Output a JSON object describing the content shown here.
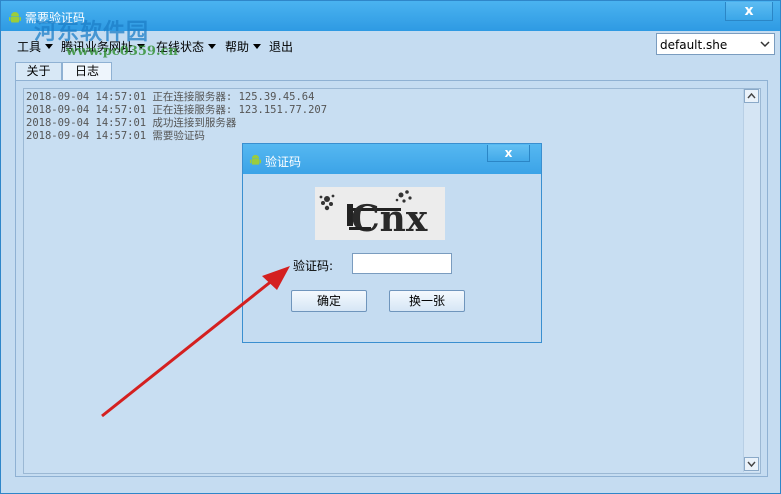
{
  "window": {
    "title": "需要验证码",
    "close_label": "x"
  },
  "watermark": {
    "text": "河东软件园",
    "url": "www.pc0359.cn"
  },
  "menu": {
    "items": [
      {
        "label": "工具",
        "dropdown": true
      },
      {
        "label": "腾讯业务网址",
        "dropdown": true
      },
      {
        "label": "在线状态",
        "dropdown": true
      },
      {
        "label": "帮助",
        "dropdown": true
      },
      {
        "label": "退出",
        "dropdown": false
      }
    ]
  },
  "combo": {
    "selected": "default.she"
  },
  "tabs": [
    {
      "label": "关于",
      "active": false
    },
    {
      "label": "日志",
      "active": true
    }
  ],
  "log": {
    "lines": [
      "2018-09-04 14:57:01 正在连接服务器: 125.39.45.64",
      "2018-09-04 14:57:01 正在连接服务器: 123.151.77.207",
      "2018-09-04 14:57:01 成功连接到服务器",
      "2018-09-04 14:57:01 需要验证码"
    ]
  },
  "dialog": {
    "title": "验证码",
    "close_label": "x",
    "captcha_text": "Cnx",
    "field_label": "验证码:",
    "field_value": "",
    "ok_label": "确定",
    "refresh_label": "换一张"
  },
  "colors": {
    "titlebar": "#2e9ae3",
    "arrow": "#d42020",
    "log_text": "#555555"
  }
}
